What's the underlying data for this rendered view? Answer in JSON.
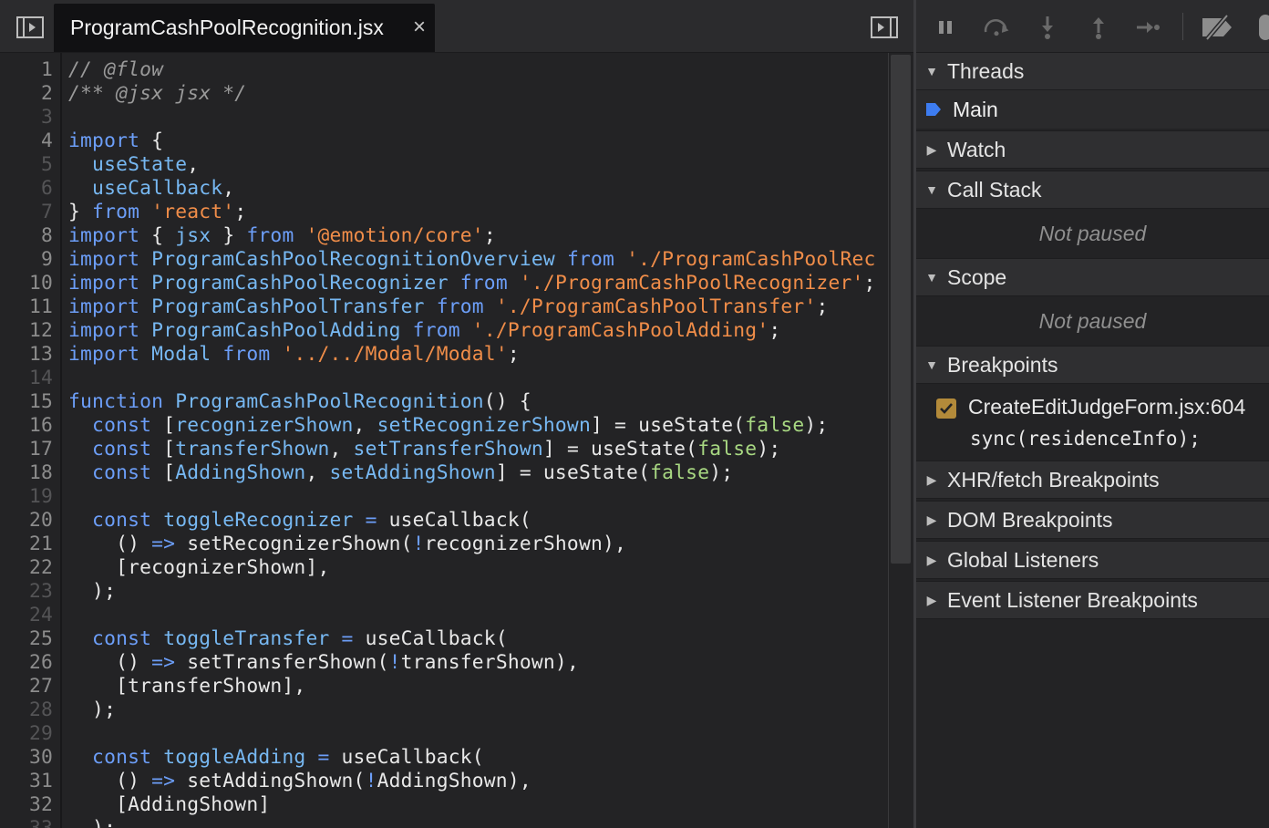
{
  "editor": {
    "tab_title": "ProgramCashPoolRecognition.jsx",
    "tab_close": "×",
    "lines": [
      {
        "n": "1",
        "dim": false,
        "t": [
          [
            "cm",
            "// @flow"
          ]
        ]
      },
      {
        "n": "2",
        "dim": false,
        "t": [
          [
            "cm",
            "/** @jsx jsx */"
          ]
        ]
      },
      {
        "n": "3",
        "dim": true,
        "t": []
      },
      {
        "n": "4",
        "dim": false,
        "t": [
          [
            "kw",
            "import"
          ],
          [
            "tx",
            " {"
          ]
        ]
      },
      {
        "n": "5",
        "dim": true,
        "t": [
          [
            "tx",
            "  "
          ],
          [
            "id",
            "useState"
          ],
          [
            "tx",
            ","
          ]
        ]
      },
      {
        "n": "6",
        "dim": true,
        "t": [
          [
            "tx",
            "  "
          ],
          [
            "id",
            "useCallback"
          ],
          [
            "tx",
            ","
          ]
        ]
      },
      {
        "n": "7",
        "dim": true,
        "t": [
          [
            "tx",
            "} "
          ],
          [
            "kw",
            "from"
          ],
          [
            "tx",
            " "
          ],
          [
            "str",
            "'react'"
          ],
          [
            "tx",
            ";"
          ]
        ]
      },
      {
        "n": "8",
        "dim": false,
        "t": [
          [
            "kw",
            "import"
          ],
          [
            "tx",
            " { "
          ],
          [
            "id",
            "jsx"
          ],
          [
            "tx",
            " } "
          ],
          [
            "kw",
            "from"
          ],
          [
            "tx",
            " "
          ],
          [
            "str",
            "'@emotion/core'"
          ],
          [
            "tx",
            ";"
          ]
        ]
      },
      {
        "n": "9",
        "dim": false,
        "t": [
          [
            "kw",
            "import"
          ],
          [
            "tx",
            " "
          ],
          [
            "id",
            "ProgramCashPoolRecognitionOverview"
          ],
          [
            "tx",
            " "
          ],
          [
            "kw",
            "from"
          ],
          [
            "tx",
            " "
          ],
          [
            "str",
            "'./ProgramCashPoolRec"
          ]
        ]
      },
      {
        "n": "10",
        "dim": false,
        "t": [
          [
            "kw",
            "import"
          ],
          [
            "tx",
            " "
          ],
          [
            "id",
            "ProgramCashPoolRecognizer"
          ],
          [
            "tx",
            " "
          ],
          [
            "kw",
            "from"
          ],
          [
            "tx",
            " "
          ],
          [
            "str",
            "'./ProgramCashPoolRecognizer'"
          ],
          [
            "tx",
            ";"
          ]
        ]
      },
      {
        "n": "11",
        "dim": false,
        "t": [
          [
            "kw",
            "import"
          ],
          [
            "tx",
            " "
          ],
          [
            "id",
            "ProgramCashPoolTransfer"
          ],
          [
            "tx",
            " "
          ],
          [
            "kw",
            "from"
          ],
          [
            "tx",
            " "
          ],
          [
            "str",
            "'./ProgramCashPoolTransfer'"
          ],
          [
            "tx",
            ";"
          ]
        ]
      },
      {
        "n": "12",
        "dim": false,
        "t": [
          [
            "kw",
            "import"
          ],
          [
            "tx",
            " "
          ],
          [
            "id",
            "ProgramCashPoolAdding"
          ],
          [
            "tx",
            " "
          ],
          [
            "kw",
            "from"
          ],
          [
            "tx",
            " "
          ],
          [
            "str",
            "'./ProgramCashPoolAdding'"
          ],
          [
            "tx",
            ";"
          ]
        ]
      },
      {
        "n": "13",
        "dim": false,
        "t": [
          [
            "kw",
            "import"
          ],
          [
            "tx",
            " "
          ],
          [
            "id",
            "Modal"
          ],
          [
            "tx",
            " "
          ],
          [
            "kw",
            "from"
          ],
          [
            "tx",
            " "
          ],
          [
            "str",
            "'../../Modal/Modal'"
          ],
          [
            "tx",
            ";"
          ]
        ]
      },
      {
        "n": "14",
        "dim": true,
        "t": []
      },
      {
        "n": "15",
        "dim": false,
        "t": [
          [
            "kw",
            "function"
          ],
          [
            "tx",
            " "
          ],
          [
            "id",
            "ProgramCashPoolRecognition"
          ],
          [
            "tx",
            "() {"
          ]
        ]
      },
      {
        "n": "16",
        "dim": false,
        "t": [
          [
            "tx",
            "  "
          ],
          [
            "kw",
            "const"
          ],
          [
            "tx",
            " ["
          ],
          [
            "id",
            "recognizerShown"
          ],
          [
            "tx",
            ", "
          ],
          [
            "id",
            "setRecognizerShown"
          ],
          [
            "tx",
            "] = useState("
          ],
          [
            "bool",
            "false"
          ],
          [
            "tx",
            ");"
          ]
        ]
      },
      {
        "n": "17",
        "dim": false,
        "t": [
          [
            "tx",
            "  "
          ],
          [
            "kw",
            "const"
          ],
          [
            "tx",
            " ["
          ],
          [
            "id",
            "transferShown"
          ],
          [
            "tx",
            ", "
          ],
          [
            "id",
            "setTransferShown"
          ],
          [
            "tx",
            "] = useState("
          ],
          [
            "bool",
            "false"
          ],
          [
            "tx",
            ");"
          ]
        ]
      },
      {
        "n": "18",
        "dim": false,
        "t": [
          [
            "tx",
            "  "
          ],
          [
            "kw",
            "const"
          ],
          [
            "tx",
            " ["
          ],
          [
            "id",
            "AddingShown"
          ],
          [
            "tx",
            ", "
          ],
          [
            "id",
            "setAddingShown"
          ],
          [
            "tx",
            "] = useState("
          ],
          [
            "bool",
            "false"
          ],
          [
            "tx",
            ");"
          ]
        ]
      },
      {
        "n": "19",
        "dim": true,
        "t": []
      },
      {
        "n": "20",
        "dim": false,
        "t": [
          [
            "tx",
            "  "
          ],
          [
            "kw",
            "const"
          ],
          [
            "tx",
            " "
          ],
          [
            "id",
            "toggleRecognizer"
          ],
          [
            "tx",
            " "
          ],
          [
            "kw",
            "="
          ],
          [
            "tx",
            " useCallback("
          ]
        ]
      },
      {
        "n": "21",
        "dim": false,
        "t": [
          [
            "tx",
            "    () "
          ],
          [
            "kw",
            "=>"
          ],
          [
            "tx",
            " setRecognizerShown("
          ],
          [
            "kw",
            "!"
          ],
          [
            "tx",
            "recognizerShown),"
          ]
        ]
      },
      {
        "n": "22",
        "dim": false,
        "t": [
          [
            "tx",
            "    [recognizerShown],"
          ]
        ]
      },
      {
        "n": "23",
        "dim": true,
        "t": [
          [
            "tx",
            "  );"
          ]
        ]
      },
      {
        "n": "24",
        "dim": true,
        "t": []
      },
      {
        "n": "25",
        "dim": false,
        "t": [
          [
            "tx",
            "  "
          ],
          [
            "kw",
            "const"
          ],
          [
            "tx",
            " "
          ],
          [
            "id",
            "toggleTransfer"
          ],
          [
            "tx",
            " "
          ],
          [
            "kw",
            "="
          ],
          [
            "tx",
            " useCallback("
          ]
        ]
      },
      {
        "n": "26",
        "dim": false,
        "t": [
          [
            "tx",
            "    () "
          ],
          [
            "kw",
            "=>"
          ],
          [
            "tx",
            " setTransferShown("
          ],
          [
            "kw",
            "!"
          ],
          [
            "tx",
            "transferShown),"
          ]
        ]
      },
      {
        "n": "27",
        "dim": false,
        "t": [
          [
            "tx",
            "    [transferShown],"
          ]
        ]
      },
      {
        "n": "28",
        "dim": true,
        "t": [
          [
            "tx",
            "  );"
          ]
        ]
      },
      {
        "n": "29",
        "dim": true,
        "t": []
      },
      {
        "n": "30",
        "dim": false,
        "t": [
          [
            "tx",
            "  "
          ],
          [
            "kw",
            "const"
          ],
          [
            "tx",
            " "
          ],
          [
            "id",
            "toggleAdding"
          ],
          [
            "tx",
            " "
          ],
          [
            "kw",
            "="
          ],
          [
            "tx",
            " useCallback("
          ]
        ]
      },
      {
        "n": "31",
        "dim": false,
        "t": [
          [
            "tx",
            "    () "
          ],
          [
            "kw",
            "=>"
          ],
          [
            "tx",
            " setAddingShown("
          ],
          [
            "kw",
            "!"
          ],
          [
            "tx",
            "AddingShown),"
          ]
        ]
      },
      {
        "n": "32",
        "dim": false,
        "t": [
          [
            "tx",
            "    [AddingShown]"
          ]
        ]
      },
      {
        "n": "33",
        "dim": true,
        "t": [
          [
            "tx",
            "  );"
          ]
        ]
      }
    ]
  },
  "sidebar": {
    "threads": {
      "label": "Threads",
      "main_label": "Main"
    },
    "watch": {
      "label": "Watch"
    },
    "call_stack": {
      "label": "Call Stack",
      "status": "Not paused"
    },
    "scope": {
      "label": "Scope",
      "status": "Not paused"
    },
    "breakpoints": {
      "label": "Breakpoints",
      "file": "CreateEditJudgeForm.jsx:604",
      "code": "sync(residenceInfo);",
      "checked": true
    },
    "xhr": {
      "label": "XHR/fetch Breakpoints"
    },
    "dom": {
      "label": "DOM Breakpoints"
    },
    "global": {
      "label": "Global Listeners"
    },
    "event": {
      "label": "Event Listener Breakpoints"
    }
  },
  "colors": {
    "keyword": "#6c9ef8",
    "identifier": "#77b8f2",
    "string": "#f08d49",
    "boolean": "#a8d882",
    "comment": "#9a9a9a",
    "thread_marker": "#3d7cf0",
    "checkbox": "#b38a3a"
  },
  "icons": {
    "toggle_sources": "sidebar-toggle-icon",
    "toggle_debugger": "sidebar-collapse-icon",
    "pause": "pause-icon",
    "step_over": "step-over-icon",
    "step_in": "step-in-icon",
    "step_out": "step-out-icon",
    "step": "step-icon",
    "deactivate_breakpoints": "deactivate-breakpoints-icon"
  }
}
